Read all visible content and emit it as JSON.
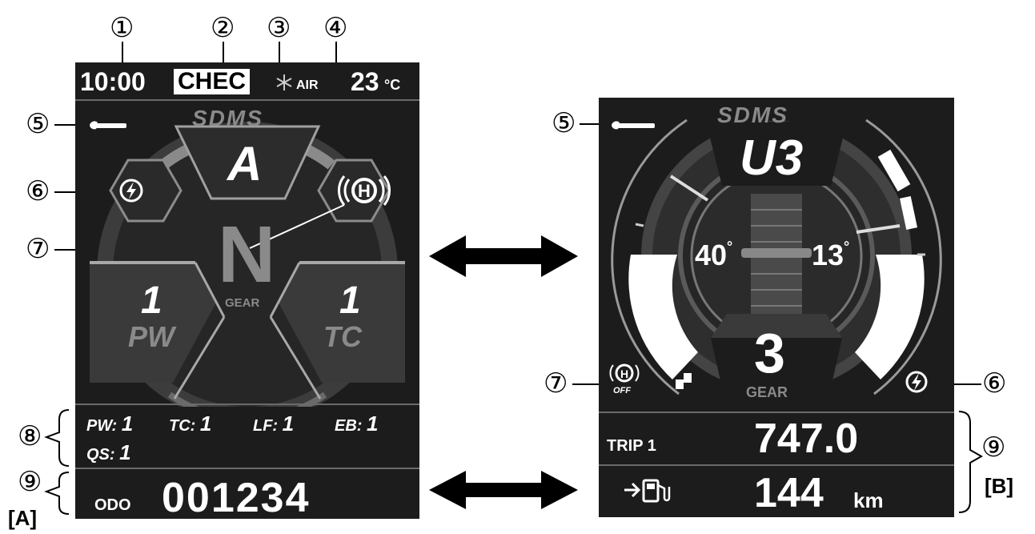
{
  "callouts": {
    "n1": "①",
    "n2": "②",
    "n3": "③",
    "n4": "④",
    "n5": "⑤",
    "n6": "⑥",
    "n7": "⑦",
    "n8": "⑧",
    "n9": "⑨"
  },
  "labels": {
    "a": "[A]",
    "b": "[B]"
  },
  "screen_a": {
    "clock": "10:00",
    "check": "CHEC",
    "air_label": "AIR",
    "air_temp": "23",
    "air_unit": "°C",
    "sdms": "SDMS",
    "mode": "A",
    "gear": "N",
    "gear_label": "GEAR",
    "pw_value": "1",
    "pw_label": "PW",
    "tc_value": "1",
    "tc_label": "TC",
    "settings": [
      {
        "label": "PW:",
        "value": "1"
      },
      {
        "label": "TC:",
        "value": "1"
      },
      {
        "label": "LF:",
        "value": "1"
      },
      {
        "label": "EB:",
        "value": "1"
      },
      {
        "label": "QS:",
        "value": "1"
      }
    ],
    "odo_label": "ODO",
    "odo_value": "001234"
  },
  "screen_b": {
    "sdms": "SDMS",
    "mode": "U3",
    "lean_left": "40",
    "lean_right": "13",
    "degree": "°",
    "gear": "3",
    "gear_label": "GEAR",
    "hhc_off": "OFF",
    "trip_label": "TRIP 1",
    "trip_value": "747.0",
    "range_value": "144",
    "range_unit": "km"
  },
  "icons": [
    "wrench-icon",
    "lightning-icon",
    "hill-hold-icon",
    "snowflake-icon",
    "fuel-pump-icon",
    "arrow-right-icon",
    "double-arrow-icon"
  ]
}
